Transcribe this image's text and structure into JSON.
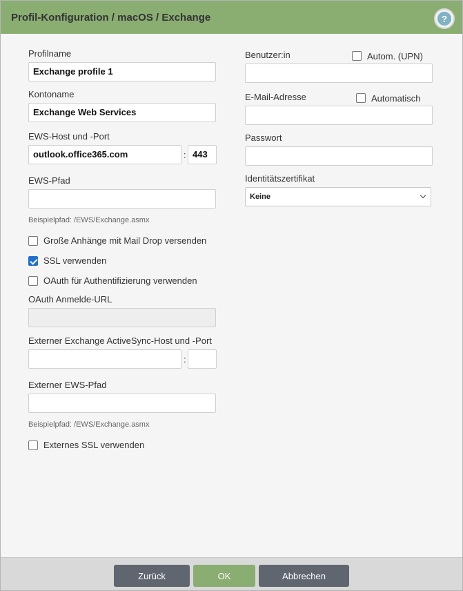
{
  "dialog": {
    "title": "Profil-Konfiguration / macOS / Exchange",
    "help_label": "?"
  },
  "left": {
    "profile_name_label": "Profilname",
    "profile_name_value": "Exchange profile 1",
    "account_name_label": "Kontoname",
    "account_name_value": "Exchange Web Services",
    "ews_host_label": "EWS-Host und -Port",
    "ews_host_value": "outlook.office365.com",
    "ews_port_value": "443",
    "colon": ":",
    "ews_path_label": "EWS-Pfad",
    "ews_path_value": "",
    "ews_path_hint": "Beispielpfad: /EWS/Exchange.asmx",
    "mail_drop_label": "Große Anhänge mit Mail Drop versenden",
    "mail_drop_checked": false,
    "ssl_label": "SSL verwenden",
    "ssl_checked": true,
    "oauth_label": "OAuth für Authentifizierung verwenden",
    "oauth_checked": false,
    "oauth_url_label": "OAuth Anmelde-URL",
    "oauth_url_value": "",
    "ext_host_label": "Externer Exchange ActiveSync-Host und -Port",
    "ext_host_value": "",
    "ext_port_value": "",
    "ext_path_label": "Externer EWS-Pfad",
    "ext_path_value": "",
    "ext_path_hint": "Beispielpfad: /EWS/Exchange.asmx",
    "ext_ssl_label": "Externes SSL verwenden",
    "ext_ssl_checked": false
  },
  "right": {
    "user_label": "Benutzer:in",
    "user_auto_label": "Autom. (UPN)",
    "user_auto_checked": false,
    "user_value": "",
    "email_label": "E-Mail-Adresse",
    "email_auto_label": "Automatisch",
    "email_auto_checked": false,
    "email_value": "",
    "password_label": "Passwort",
    "password_value": "",
    "identity_label": "Identitätszertifikat",
    "identity_selected": "Keine"
  },
  "footer": {
    "back_label": "Zurück",
    "ok_label": "OK",
    "cancel_label": "Abbrechen"
  },
  "colors": {
    "accent": "#8aad72",
    "button_gray": "#5f6670",
    "checkbox_checked": "#1f6fd1"
  }
}
